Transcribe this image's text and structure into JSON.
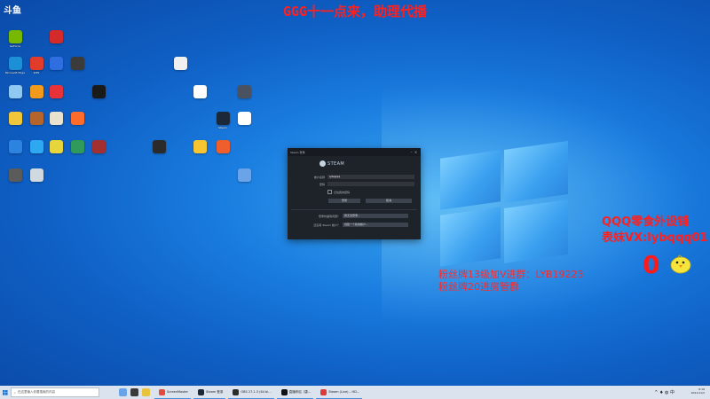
{
  "overlay": {
    "top_banner": "GGG十一点来，助理代播",
    "right_line1": "QQQ零食外设铺",
    "right_line2": "表妹VX:lybqqq01",
    "counter": "0",
    "mid_line1": "粉丝牌13级加V进群：LYB19223",
    "mid_line2": "粉丝牌20进房管群",
    "corner_logo": "斗鱼"
  },
  "colors": {
    "overlay_red": "#ff2020",
    "desktop_blue": "#1a7de0"
  },
  "desktop_icons": [
    {
      "name": "nvidia",
      "label": "GeForce",
      "color": "#76b900"
    },
    {
      "name": "app-red",
      "label": "",
      "color": "#d42a2a"
    },
    {
      "name": "edge",
      "label": "Microsoft Edge",
      "color": "#1c8fd6"
    },
    {
      "name": "wps",
      "label": "WPS",
      "color": "#e03b2b"
    },
    {
      "name": "baidu",
      "label": "",
      "color": "#2f6ee0"
    },
    {
      "name": "game-a",
      "label": "",
      "color": "#3b3b3b"
    },
    {
      "name": "doc",
      "label": "",
      "color": "#f0f0f0"
    },
    {
      "name": "recycle",
      "label": "",
      "color": "#8fc8f0"
    },
    {
      "name": "steelseries",
      "label": "",
      "color": "#f29a1b"
    },
    {
      "name": "netease",
      "label": "",
      "color": "#e8323a"
    },
    {
      "name": "logitech",
      "label": "",
      "color": "#1a1a1a"
    },
    {
      "name": "kuaishou",
      "label": "",
      "color": "#ffffff"
    },
    {
      "name": "app-gray",
      "label": "",
      "color": "#4a5160"
    },
    {
      "name": "qq-folder",
      "label": "",
      "color": "#f2c63b"
    },
    {
      "name": "game-b",
      "label": "",
      "color": "#b5652c"
    },
    {
      "name": "settings",
      "label": "",
      "color": "#e9e2ce"
    },
    {
      "name": "mi",
      "label": "",
      "color": "#ff6b2b"
    },
    {
      "name": "steam",
      "label": "Steam",
      "color": "#1b2838"
    },
    {
      "name": "file",
      "label": "",
      "color": "#ffffff"
    },
    {
      "name": "sogou",
      "label": "",
      "color": "#2c84e0"
    },
    {
      "name": "kugou",
      "label": "",
      "color": "#2ea8f0"
    },
    {
      "name": "cartoon",
      "label": "",
      "color": "#e6d63b"
    },
    {
      "name": "game-c",
      "label": "",
      "color": "#a33030"
    },
    {
      "name": "obs",
      "label": "",
      "color": "#2b2b2b"
    },
    {
      "name": "qqmusic",
      "label": "",
      "color": "#f7c531"
    },
    {
      "name": "capture",
      "label": "",
      "color": "#f05f2b"
    },
    {
      "name": "game-d",
      "label": "",
      "color": "#5b5b5b"
    },
    {
      "name": "remote",
      "label": "",
      "color": "#d0d8e0"
    },
    {
      "name": "netdisk",
      "label": "",
      "color": "#6aa4e8"
    },
    {
      "name": "folder-green",
      "label": "",
      "color": "#2f9a5a"
    }
  ],
  "steam": {
    "title": "Steam 登录",
    "brand": "STEAM",
    "account_label": "帐户名称",
    "account_value": "lybqqqq",
    "password_label": "密码",
    "password_value": "",
    "remember_label": "记住我的密码",
    "login_button": "登录",
    "cancel_button": "取消",
    "help_text": "登录时遇到问题？",
    "help_button": "我无法登录…",
    "new_text": "还没有 Steam 帐户？",
    "new_button": "创建一个新的帐户…",
    "min": "–",
    "close": "×"
  },
  "taskbar": {
    "search_placeholder": "在这里输入你要搜索的内容",
    "apps": [
      {
        "label": "",
        "color": "#6aa4e8"
      },
      {
        "label": "",
        "color": "#3a3a3a"
      },
      {
        "label": "",
        "color": "#e8c33b"
      },
      {
        "label": "ScreenMaster",
        "color": "#e24a3b"
      },
      {
        "label": "Steam 登录",
        "color": "#1b2838"
      },
      {
        "label": "OBS 27.1.3 (64 bi…",
        "color": "#2b2b2b"
      },
      {
        "label": "直播伴侣（唐…",
        "color": "#111111"
      },
      {
        "label": "Steam (Live) – HD…",
        "color": "#d93b3b"
      }
    ],
    "time": "8:16",
    "date": "2021/11/2",
    "tray_icons": "^ ♦ ◍ 中"
  }
}
